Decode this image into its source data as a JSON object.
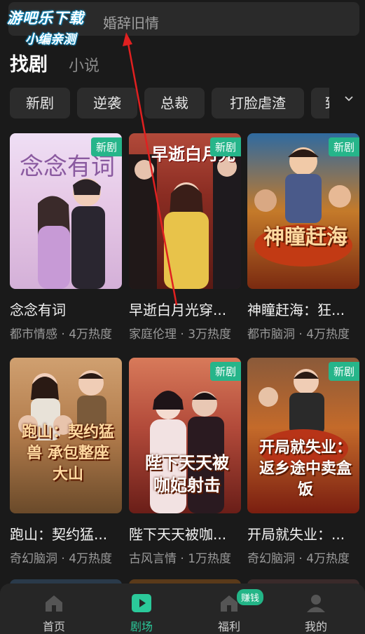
{
  "search": {
    "text": "婚辞旧情"
  },
  "watermark": {
    "line1": "游吧乐下载",
    "line2": "小编亲测"
  },
  "tabs": {
    "active": "找剧",
    "inactive": "小说"
  },
  "categories": [
    "新剧",
    "逆袭",
    "总裁",
    "打脸虐渣",
    "致"
  ],
  "badge_label": "新剧",
  "dramas": [
    {
      "title": "念念有词",
      "meta": "都市情感 · 4万热度",
      "poster_text": "念念有词",
      "badge": true
    },
    {
      "title": "早逝白月光穿...",
      "meta": "家庭伦理 · 3万热度",
      "poster_text": "早逝白月光",
      "badge": true
    },
    {
      "title": "神瞳赶海：狂...",
      "meta": "都市脑洞 · 4万热度",
      "poster_text": "神瞳赶海",
      "badge": true
    },
    {
      "title": "跑山：契约猛...",
      "meta": "奇幻脑洞 · 4万热度",
      "poster_text": "跑山：契约猛兽 承包整座大山",
      "badge": false
    },
    {
      "title": "陛下天天被咖...",
      "meta": "古风言情 · 1万热度",
      "poster_text": "陛下天天被 咖妃射击",
      "badge": true
    },
    {
      "title": "开局就失业：...",
      "meta": "奇幻脑洞 · 4万热度",
      "poster_text": "开局就失业： 返乡途中卖盒饭",
      "badge": true
    }
  ],
  "nav": [
    {
      "label": "首页",
      "icon": "home-icon",
      "active": false
    },
    {
      "label": "剧场",
      "icon": "play-icon",
      "active": true
    },
    {
      "label": "福利",
      "icon": "gift-icon",
      "active": false
    },
    {
      "label": "我的",
      "icon": "user-icon",
      "active": false
    }
  ],
  "nav_badge": "赚钱",
  "colors": {
    "accent": "#2bc99a",
    "badge": "#26b58a",
    "background": "#1a1a1a"
  }
}
